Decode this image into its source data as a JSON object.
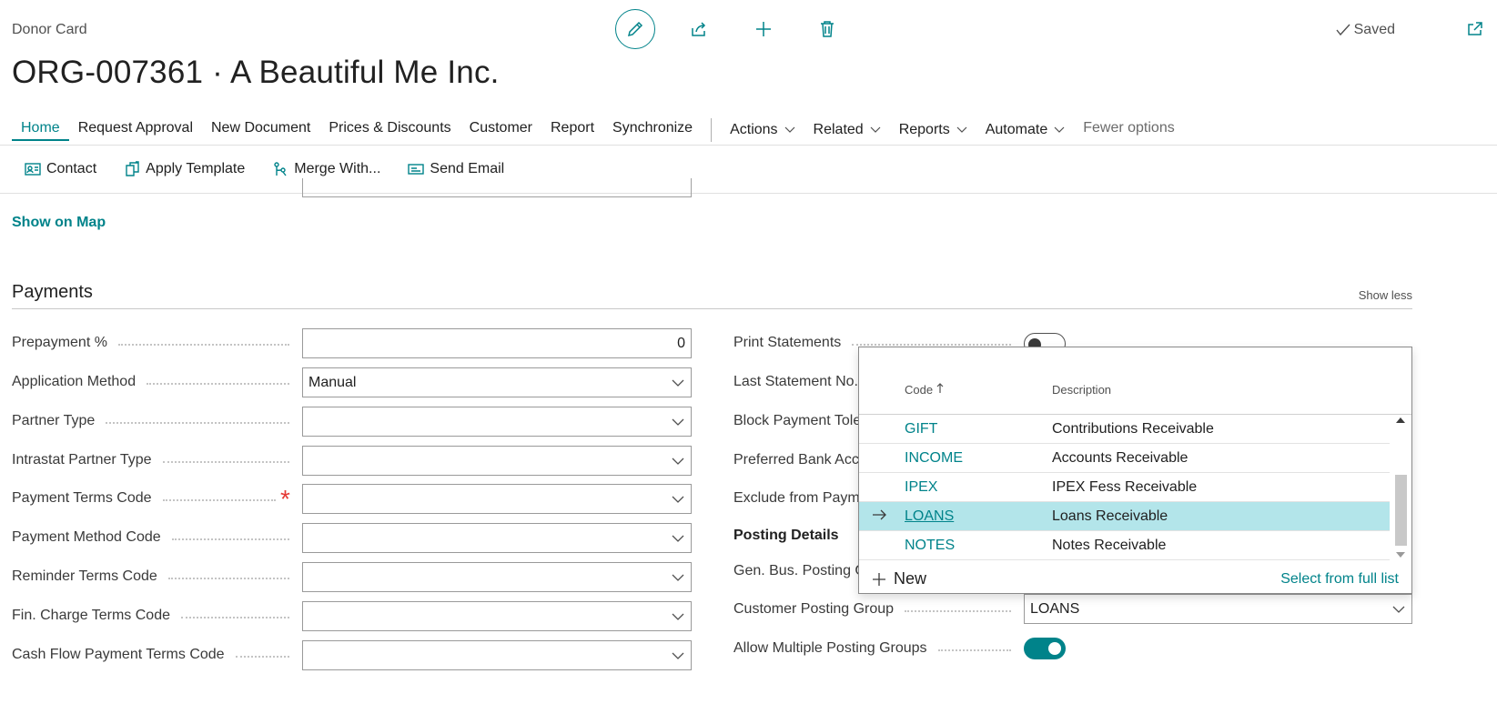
{
  "header": {
    "caption": "Donor Card",
    "title": "ORG-007361 · A Beautiful Me Inc.",
    "saved_label": "Saved"
  },
  "tabs": [
    {
      "label": "Home",
      "active": true
    },
    {
      "label": "Request Approval"
    },
    {
      "label": "New Document"
    },
    {
      "label": "Prices & Discounts"
    },
    {
      "label": "Customer"
    },
    {
      "label": "Report"
    },
    {
      "label": "Synchronize"
    }
  ],
  "menus": [
    "Actions",
    "Related",
    "Reports",
    "Automate"
  ],
  "fewer_options": "Fewer options",
  "subtabs": [
    "Contact",
    "Apply Template",
    "Merge With...",
    "Send Email"
  ],
  "show_on_map": "Show on Map",
  "section": {
    "title": "Payments",
    "show_less": "Show less"
  },
  "left_fields": [
    {
      "label": "Prepayment %",
      "value": "0"
    },
    {
      "label": "Application Method",
      "value": "Manual"
    },
    {
      "label": "Partner Type",
      "value": ""
    },
    {
      "label": "Intrastat Partner Type",
      "value": ""
    },
    {
      "label": "Payment Terms Code",
      "value": ""
    },
    {
      "label": "Payment Method Code",
      "value": ""
    },
    {
      "label": "Reminder Terms Code",
      "value": ""
    },
    {
      "label": "Fin. Charge Terms Code",
      "value": ""
    },
    {
      "label": "Cash Flow Payment Terms Code",
      "value": ""
    }
  ],
  "right_fields": {
    "print_statements": "Print Statements",
    "last_statement_no": "Last Statement No.",
    "block_payment_tolerance": "Block Payment Tole",
    "preferred_bank_account": "Preferred Bank Acco",
    "exclude_from_payment": "Exclude from Payme",
    "posting_details": "Posting Details",
    "gen_bus_posting": "Gen. Bus. Posting G",
    "customer_posting_group": "Customer Posting Group",
    "customer_posting_group_value": "LOANS",
    "allow_multiple": "Allow Multiple Posting Groups"
  },
  "lookup": {
    "col_code": "Code",
    "col_description": "Description",
    "rows": [
      {
        "code": "GIFT",
        "description": "Contributions Receivable"
      },
      {
        "code": "INCOME",
        "description": "Accounts Receivable"
      },
      {
        "code": "IPEX",
        "description": "IPEX Fess Receivable"
      },
      {
        "code": "LOANS",
        "description": "Loans Receivable",
        "selected": true
      },
      {
        "code": "NOTES",
        "description": "Notes Receivable"
      }
    ],
    "new_label": "New",
    "select_full": "Select from full list"
  },
  "colors": {
    "accent": "#00838a",
    "selection": "#b3e5ea",
    "required": "#e53935"
  }
}
